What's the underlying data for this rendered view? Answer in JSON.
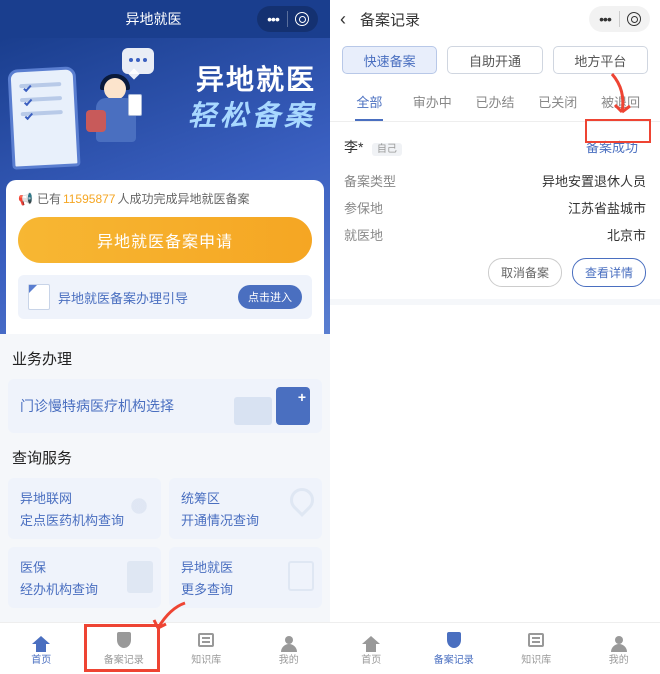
{
  "left": {
    "header_title": "异地就医",
    "banner_h1": "异地就医",
    "banner_h2": "轻松备案",
    "counter_prefix": "已有",
    "counter_number": "11595877",
    "counter_suffix": "人成功完成异地就医备案",
    "big_button": "异地就医备案申请",
    "guide_text": "异地就医备案办理引导",
    "guide_button": "点击进入",
    "section_biz": "业务办理",
    "biz_card": "门诊慢特病医疗机构选择",
    "section_query": "查询服务",
    "query_cards": [
      {
        "line1": "异地联网",
        "line2": "定点医药机构查询"
      },
      {
        "line1": "统筹区",
        "line2": "开通情况查询"
      },
      {
        "line1": "医保",
        "line2": "经办机构查询"
      },
      {
        "line1": "异地就医",
        "line2": "更多查询"
      }
    ],
    "tabs": [
      "首页",
      "备案记录",
      "知识库",
      "我的"
    ]
  },
  "right": {
    "header_title": "备案记录",
    "chips": [
      "快速备案",
      "自助开通",
      "地方平台"
    ],
    "filter_tabs": [
      "全部",
      "审办中",
      "已办结",
      "已关闭",
      "被退回"
    ],
    "record": {
      "name": "李*",
      "relation": "自己",
      "status": "备案成功",
      "fields": [
        {
          "label": "备案类型",
          "value": "异地安置退休人员"
        },
        {
          "label": "参保地",
          "value": "江苏省盐城市"
        },
        {
          "label": "就医地",
          "value": "北京市"
        }
      ],
      "action_cancel": "取消备案",
      "action_detail": "查看详情"
    },
    "tabs": [
      "首页",
      "备案记录",
      "知识库",
      "我的"
    ]
  }
}
